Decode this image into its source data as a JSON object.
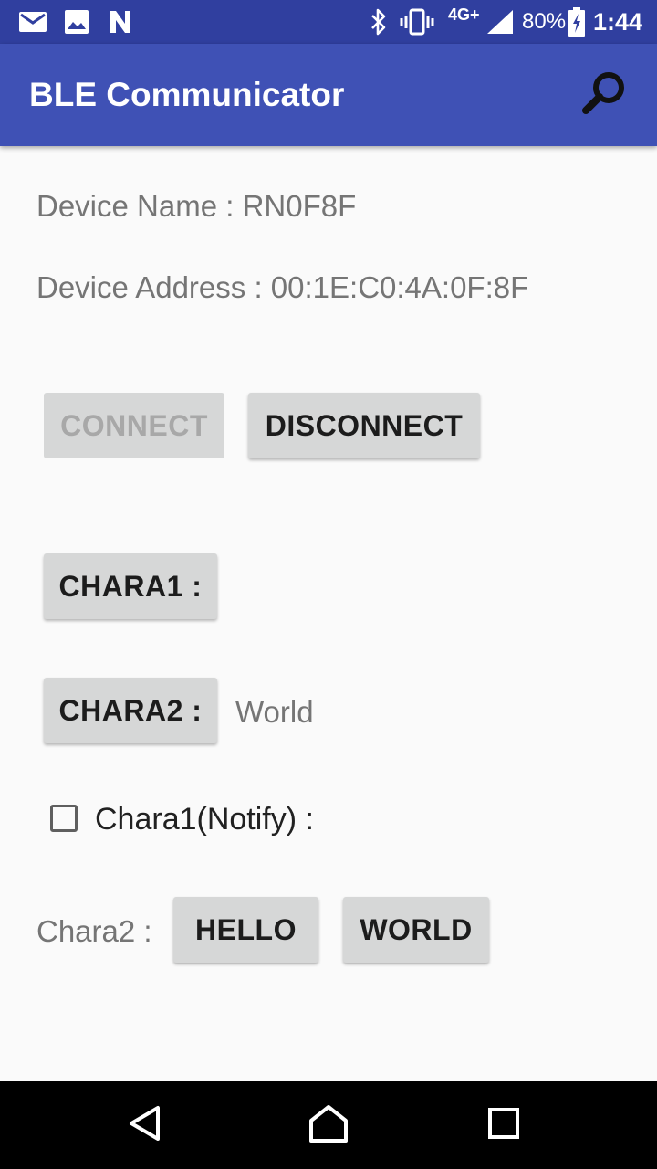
{
  "status_bar": {
    "network": "4G+",
    "battery": "80%",
    "time": "1:44",
    "icons": [
      "mail-icon",
      "image-icon",
      "n-logo-icon",
      "bluetooth-icon",
      "vibrate-icon",
      "signal-icon",
      "battery-charging-icon"
    ]
  },
  "app_bar": {
    "title": "BLE Communicator",
    "action_icon": "search-icon"
  },
  "device": {
    "name_line": "Device Name : RN0F8F",
    "address_line": "Device Address : 00:1E:C0:4A:0F:8F"
  },
  "buttons": {
    "connect": "CONNECT",
    "disconnect": "DISCONNECT",
    "chara1": "CHARA1 :",
    "chara2": "CHARA2 :",
    "hello": "HELLO",
    "world": "WORLD"
  },
  "chara1_value": "",
  "chara2_value": "World",
  "notify_checkbox": {
    "label": "Chara1(Notify) :",
    "checked": false
  },
  "chara2_label": "Chara2 :",
  "colors": {
    "primary": "#3f51b5",
    "primary_dark": "#303f9f",
    "button": "#d6d7d7",
    "background": "#fafafa"
  },
  "nav_bar": {
    "icons": [
      "back-icon",
      "home-icon",
      "recents-icon"
    ]
  }
}
